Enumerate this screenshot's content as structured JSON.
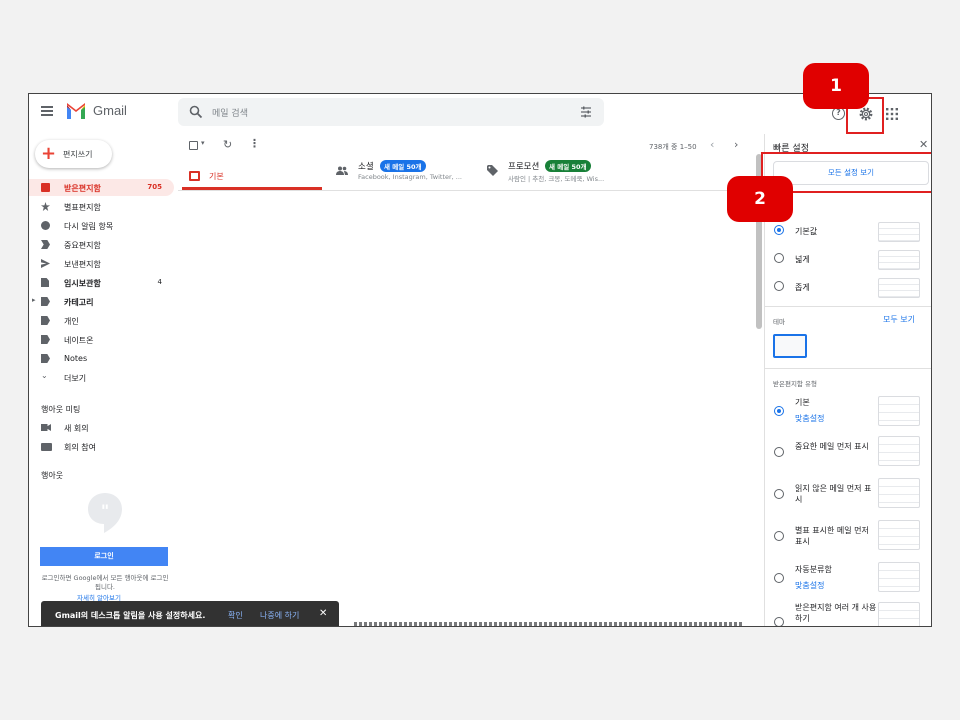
{
  "header": {
    "app_name": "Gmail",
    "search_placeholder": "메일 검색"
  },
  "sidebar": {
    "compose_label": "편지쓰기",
    "items": [
      {
        "label": "받은편지함",
        "count": "705"
      },
      {
        "label": "별표편지함",
        "count": ""
      },
      {
        "label": "다시 알림 항목",
        "count": ""
      },
      {
        "label": "중요편지함",
        "count": ""
      },
      {
        "label": "보낸편지함",
        "count": ""
      },
      {
        "label": "임시보관함",
        "count": "4"
      },
      {
        "label": "카테고리",
        "count": ""
      },
      {
        "label": "개인",
        "count": ""
      },
      {
        "label": "네이트온",
        "count": ""
      },
      {
        "label": "Notes",
        "count": ""
      },
      {
        "label": "더보기",
        "count": ""
      }
    ],
    "meet_title": "행아웃 미팅",
    "meet_items": [
      "새 회의",
      "회의 참여"
    ],
    "hangouts_title": "행아웃",
    "login_button": "로그인",
    "login_desc": "로그인하면 Google에서 모든 행아웃에 로그인됩니다.",
    "login_link": "자세히 알아보기"
  },
  "toolbar": {
    "page_info": "738개 중 1–50"
  },
  "tabs": [
    {
      "name": "기본"
    },
    {
      "name": "소셜",
      "badge": "새 메일 50개",
      "badge_color": "#1a73e8",
      "sub": "Facebook, Instagram, Twitter, ..."
    },
    {
      "name": "프로모션",
      "badge": "새 메일 50개",
      "badge_color": "#188038",
      "sub": "사람인 | 추천, 크몽, 도메쿡, Wis..."
    }
  ],
  "quick_settings": {
    "title": "빠른 설정",
    "all_settings_button": "모든 설정 보기",
    "density": [
      {
        "label": "기본값",
        "selected": true
      },
      {
        "label": "넓게",
        "selected": false
      },
      {
        "label": "좁게",
        "selected": false
      }
    ],
    "theme_label": "테마",
    "theme_view_all": "모두 보기",
    "inbox_type_label": "받은편지함 유형",
    "inbox_types": [
      {
        "label": "기본",
        "custom": "맞춤설정",
        "selected": true
      },
      {
        "label": "중요한 메일 먼저 표시",
        "selected": false
      },
      {
        "label": "읽지 않은 메일 먼저 표시",
        "selected": false
      },
      {
        "label": "별표 표시한 메일 먼저 표시",
        "selected": false
      },
      {
        "label": "자동분류함",
        "custom": "맞춤설정",
        "selected": false
      },
      {
        "label": "받은편지함 여러 개 사용하기",
        "selected": false
      }
    ]
  },
  "toast": {
    "message": "Gmail의 데스크톱 알림을 사용 설정하세요.",
    "confirm": "확인",
    "later": "나중에 하기"
  },
  "steps": [
    "1",
    "2"
  ],
  "colors": {
    "accent_red": "#d93025",
    "link_blue": "#1a73e8",
    "highlight": "#e02020"
  }
}
